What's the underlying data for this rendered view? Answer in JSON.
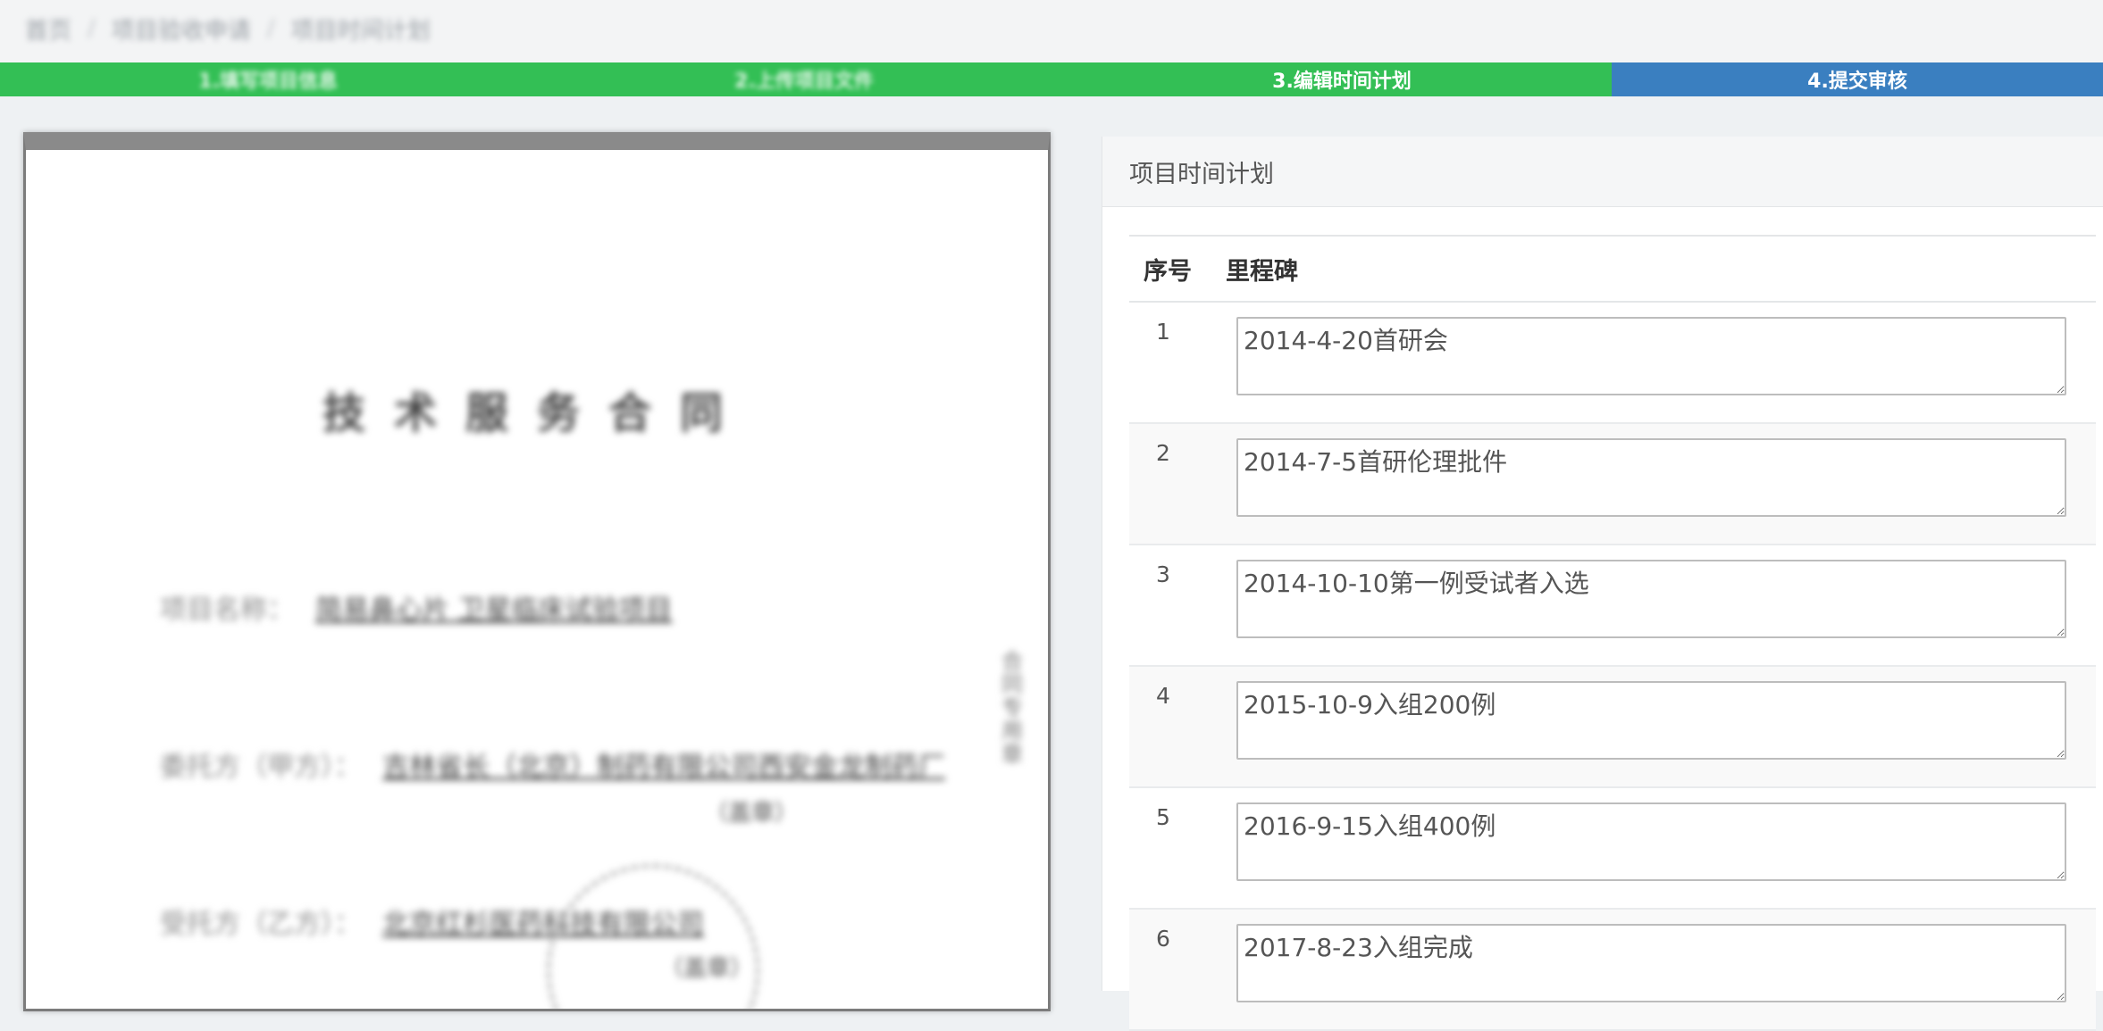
{
  "breadcrumb": [
    "首页",
    "项目验收申请",
    "项目时间计划"
  ],
  "steps": [
    "1.填写项目信息",
    "2.上传项目文件",
    "3.编辑时间计划",
    "4.提交审核"
  ],
  "document": {
    "title": "技术服务合同",
    "lines": [
      {
        "label": "项目名称：",
        "value": "简易鼻心片 卫星临床试验项目"
      },
      {
        "label": "委托方（甲方）：",
        "value": "吉林省长（北京）制药有限公司西安金龙制药厂"
      },
      {
        "label": "受托方（乙方）：",
        "value": "北京红杉医药科技有限公司"
      }
    ],
    "stamp_label": "（盖章）",
    "side_text": "合同专用章"
  },
  "panel": {
    "title": "项目时间计划",
    "columns": [
      "序号",
      "里程碑"
    ],
    "rows": [
      {
        "no": "1",
        "milestone": "2014-4-20首研会"
      },
      {
        "no": "2",
        "milestone": "2014-7-5首研伦理批件"
      },
      {
        "no": "3",
        "milestone": "2014-10-10第一例受试者入选"
      },
      {
        "no": "4",
        "milestone": "2015-10-9入组200例"
      },
      {
        "no": "5",
        "milestone": "2016-9-15入组400例"
      },
      {
        "no": "6",
        "milestone": "2017-8-23入组完成"
      }
    ]
  }
}
